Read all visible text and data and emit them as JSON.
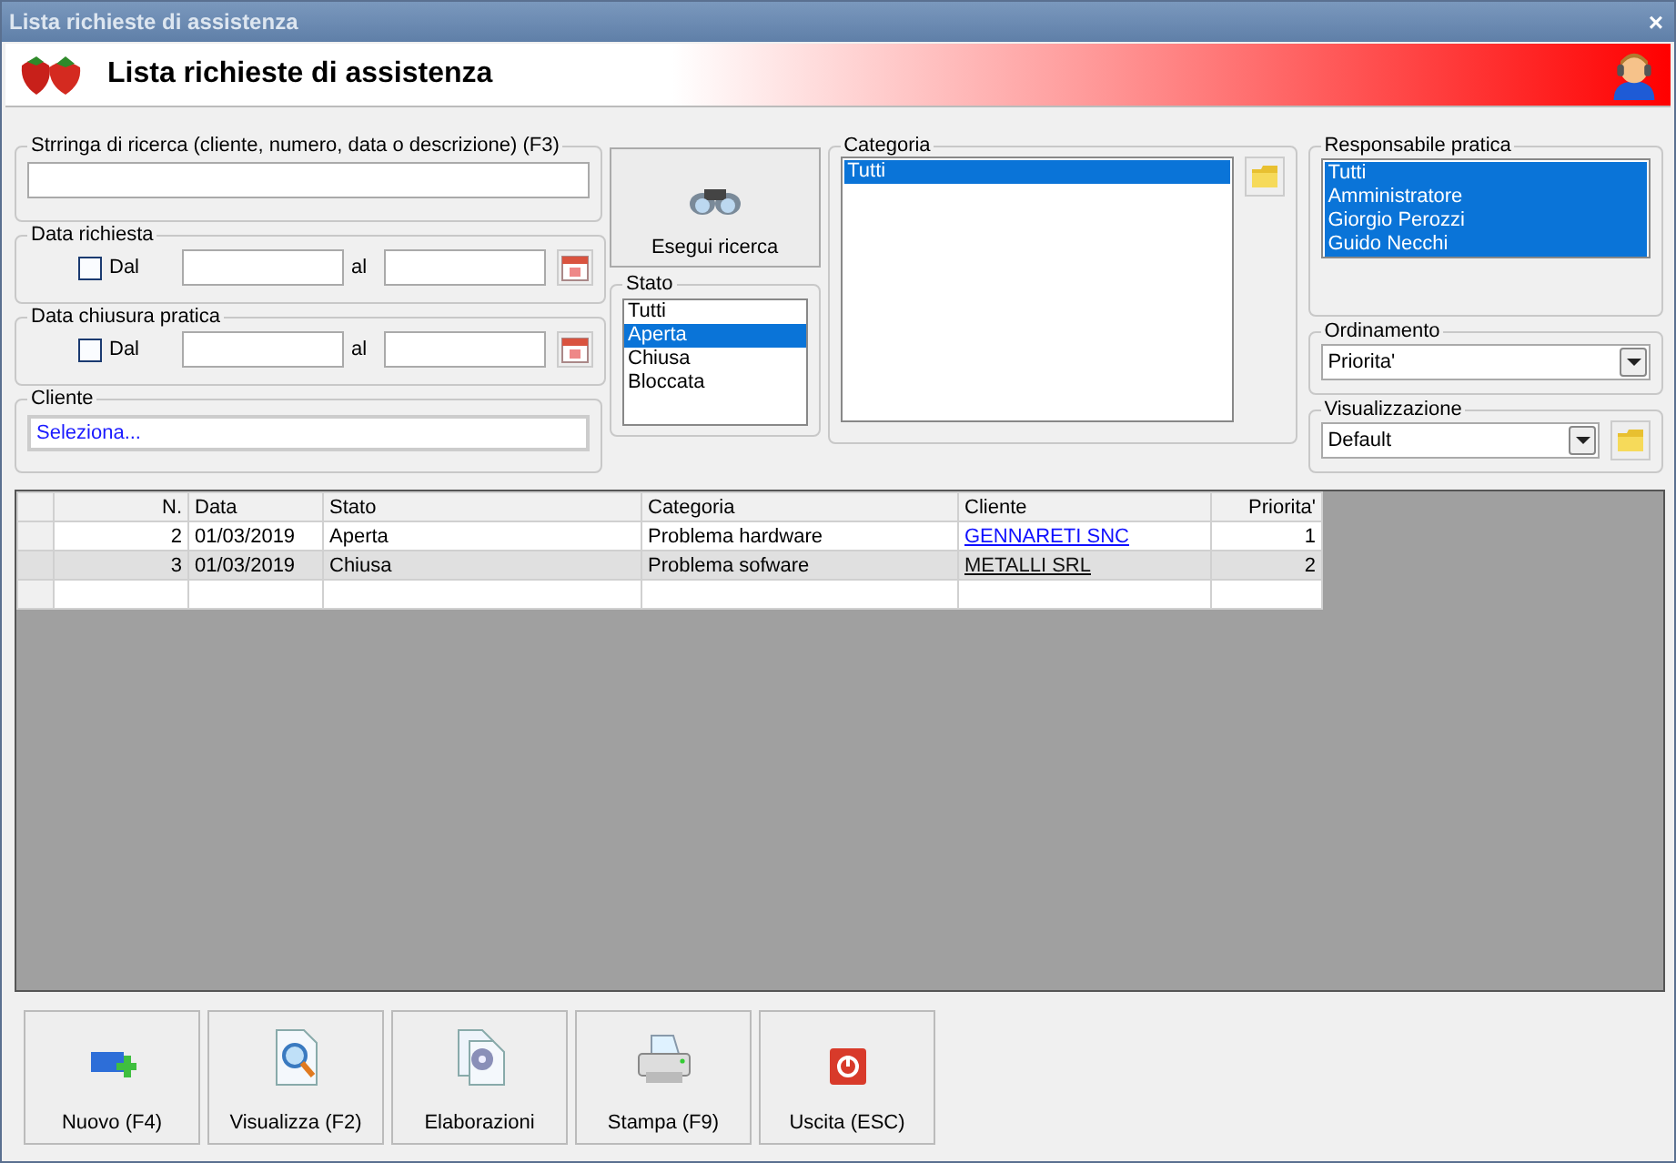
{
  "window": {
    "title": "Lista richieste di assistenza",
    "close": "×"
  },
  "header": {
    "title": "Lista richieste di assistenza"
  },
  "search": {
    "legend": "Strringa di ricerca (cliente, numero, data o descrizione) (F3)"
  },
  "date_groups": [
    {
      "legend": "Data richiesta",
      "check_label": "Dal",
      "checked": false,
      "to_label": "al"
    },
    {
      "legend": "Data chiusura pratica",
      "check_label": "Dal",
      "checked": false,
      "to_label": "al"
    }
  ],
  "cliente": {
    "legend": "Cliente",
    "value": "Seleziona..."
  },
  "search_button": "Esegui ricerca",
  "stato": {
    "legend": "Stato",
    "items": [
      {
        "label": "Tutti",
        "selected": false
      },
      {
        "label": "Aperta",
        "selected": true
      },
      {
        "label": "Chiusa",
        "selected": false
      },
      {
        "label": "Bloccata",
        "selected": false
      }
    ]
  },
  "categoria": {
    "legend": "Categoria",
    "items": [
      {
        "label": "Tutti",
        "selected": true
      }
    ]
  },
  "responsabile": {
    "legend": "Responsabile pratica",
    "items": [
      {
        "label": "Tutti",
        "selected": true
      },
      {
        "label": "Amministratore",
        "selected": true
      },
      {
        "label": "Giorgio Perozzi",
        "selected": true
      },
      {
        "label": "Guido Necchi",
        "selected": true
      }
    ]
  },
  "ordinamento": {
    "legend": "Ordinamento",
    "value": "Priorita'"
  },
  "visualizzazione": {
    "legend": "Visualizzazione",
    "value": "Default"
  },
  "table": {
    "columns": [
      "N.",
      "Data",
      "Stato",
      "Categoria",
      "Cliente",
      "Priorita'"
    ],
    "rows": [
      {
        "cells": [
          "2",
          "01/03/2019",
          "Aperta",
          "Problema hardware",
          "GENNARETI SNC",
          "1"
        ],
        "selected": false
      },
      {
        "cells": [
          "3",
          "01/03/2019",
          "Chiusa",
          "Problema sofware",
          "METALLI SRL",
          "2"
        ],
        "selected": true
      }
    ]
  },
  "buttons": [
    {
      "label": "Nuovo (F4)",
      "kind": "new"
    },
    {
      "label": "Visualizza (F2)",
      "kind": "view"
    },
    {
      "label": "Elaborazioni",
      "kind": "process"
    },
    {
      "label": "Stampa (F9)",
      "kind": "print"
    },
    {
      "label": "Uscita (ESC)",
      "kind": "exit"
    }
  ]
}
